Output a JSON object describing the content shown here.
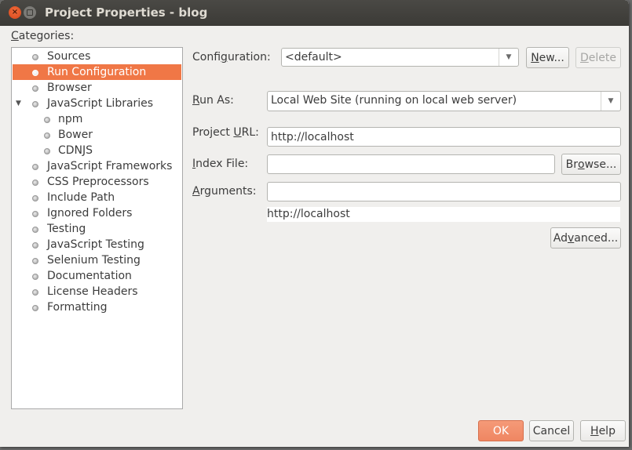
{
  "window": {
    "title": "Project Properties - blog",
    "controls": [
      "close-icon",
      "maximize-icon"
    ]
  },
  "categories": {
    "label_mnemonic": "C",
    "label_rest": "ategories:",
    "items": [
      {
        "label": "Sources",
        "level": 0,
        "selected": false
      },
      {
        "label": "Run Configuration",
        "level": 0,
        "selected": true
      },
      {
        "label": "Browser",
        "level": 0,
        "selected": false
      },
      {
        "label": "JavaScript Libraries",
        "level": 0,
        "selected": false,
        "expanded": true
      },
      {
        "label": "npm",
        "level": 1,
        "selected": false
      },
      {
        "label": "Bower",
        "level": 1,
        "selected": false
      },
      {
        "label": "CDNJS",
        "level": 1,
        "selected": false
      },
      {
        "label": "JavaScript Frameworks",
        "level": 0,
        "selected": false
      },
      {
        "label": "CSS Preprocessors",
        "level": 0,
        "selected": false
      },
      {
        "label": "Include Path",
        "level": 0,
        "selected": false
      },
      {
        "label": "Ignored Folders",
        "level": 0,
        "selected": false
      },
      {
        "label": "Testing",
        "level": 0,
        "selected": false
      },
      {
        "label": "JavaScript Testing",
        "level": 0,
        "selected": false
      },
      {
        "label": "Selenium Testing",
        "level": 0,
        "selected": false
      },
      {
        "label": "Documentation",
        "level": 0,
        "selected": false
      },
      {
        "label": "License Headers",
        "level": 0,
        "selected": false
      },
      {
        "label": "Formatting",
        "level": 0,
        "selected": false
      }
    ]
  },
  "form": {
    "configuration": {
      "label_pre": "Confi",
      "label_mn": "g",
      "label_post": "uration:",
      "value": "<default>"
    },
    "new_button": {
      "mn": "N",
      "rest": "ew..."
    },
    "delete_button": {
      "mn": "D",
      "rest": "elete"
    },
    "run_as": {
      "label_mn": "R",
      "label_post": "un As:",
      "value": "Local Web Site (running on local web server)"
    },
    "project_url": {
      "label_pre": "Project ",
      "label_mn": "U",
      "label_post": "RL:",
      "value": "http://localhost"
    },
    "index_file": {
      "label_mn": "I",
      "label_post": "ndex File:",
      "value": ""
    },
    "browse_button": {
      "pre": "Br",
      "mn": "o",
      "post": "wse..."
    },
    "arguments": {
      "label_mn": "A",
      "label_post": "rguments:",
      "value": ""
    },
    "url_preview": "http://localhost",
    "advanced_button": {
      "pre": "Ad",
      "mn": "v",
      "post": "anced..."
    }
  },
  "footer": {
    "ok": "OK",
    "cancel": "Cancel",
    "help": {
      "mn": "H",
      "rest": "elp"
    }
  },
  "colors": {
    "accent": "#f07746",
    "titlebar": "#3b3a36",
    "background": "#f0efed"
  }
}
